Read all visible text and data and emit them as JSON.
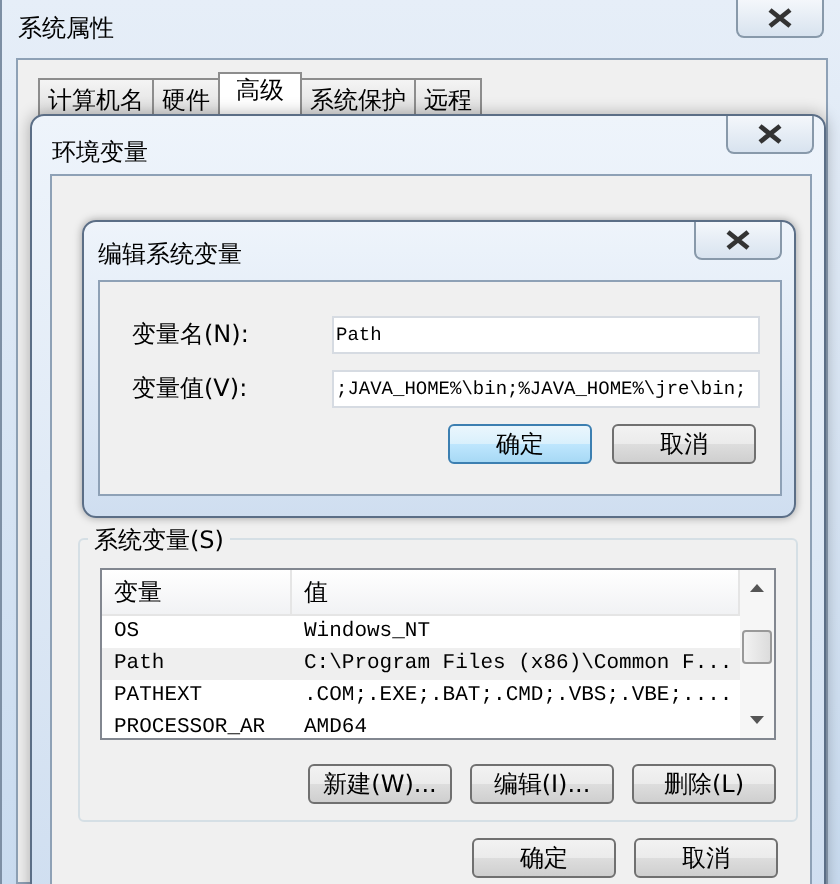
{
  "system_properties": {
    "title": "系统属性",
    "tabs": [
      {
        "label": "计算机名",
        "selected": false
      },
      {
        "label": "硬件",
        "selected": false
      },
      {
        "label": "高级",
        "selected": true
      },
      {
        "label": "系统保护",
        "selected": false
      },
      {
        "label": "远程",
        "selected": false
      }
    ]
  },
  "environment_variables": {
    "title": "环境变量",
    "system_variables": {
      "label": "系统变量(S)",
      "columns": [
        "变量",
        "值"
      ],
      "rows": [
        {
          "name": "OS",
          "value": "Windows_NT",
          "selected": false
        },
        {
          "name": "Path",
          "value": "C:\\Program Files (x86)\\Common F...",
          "selected": true
        },
        {
          "name": "PATHEXT",
          "value": ".COM;.EXE;.BAT;.CMD;.VBS;.VBE;....",
          "selected": false
        },
        {
          "name": "PROCESSOR_AR",
          "value": "AMD64",
          "selected": false
        }
      ],
      "buttons": [
        "新建(W)...",
        "编辑(I)...",
        "删除(L)"
      ]
    },
    "buttons": [
      {
        "label": "确定",
        "default": false
      },
      {
        "label": "取消",
        "default": false
      }
    ]
  },
  "edit_dialog": {
    "title": "编辑系统变量",
    "fields": [
      {
        "label": "变量名(N):",
        "value": "Path"
      },
      {
        "label": "变量值(V):",
        "value": ";JAVA_HOME%\\bin;%JAVA_HOME%\\jre\\bin;"
      }
    ],
    "buttons": [
      {
        "label": "确定",
        "default": true
      },
      {
        "label": "取消",
        "default": false
      }
    ]
  }
}
